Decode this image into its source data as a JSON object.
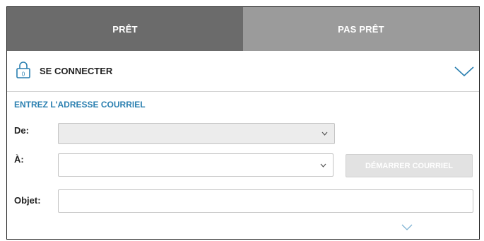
{
  "tabs": {
    "ready": "PRÊT",
    "not_ready": "PAS PRÊT"
  },
  "login": {
    "label": "SE CONNECTER",
    "icon": "lock-icon"
  },
  "email_form": {
    "title": "ENTREZ L'ADRESSE COURRIEL",
    "from_label": "De:",
    "from_value": "",
    "to_label": "À:",
    "to_value": "",
    "start_button": "DÉMARRER COURRIEL",
    "subject_label": "Objet:",
    "subject_value": ""
  },
  "colors": {
    "tab_active": "#6b6b6b",
    "tab_inactive": "#9b9b9b",
    "accent": "#2a7fb0",
    "disabled_button": "#e2e2e2"
  }
}
